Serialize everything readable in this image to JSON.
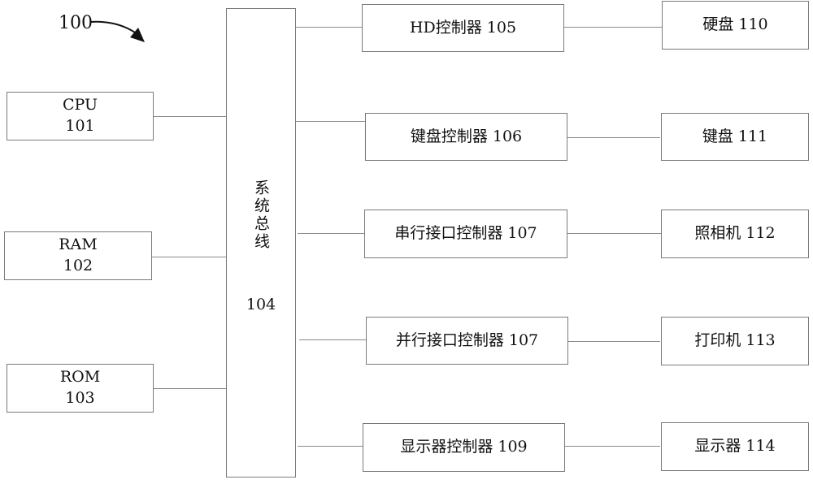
{
  "figure_ref": "100",
  "bus": {
    "title": "系统总线",
    "number": "104"
  },
  "left_components": [
    {
      "name": "CPU",
      "number": "101"
    },
    {
      "name": "RAM",
      "number": "102"
    },
    {
      "name": "ROM",
      "number": "103"
    }
  ],
  "controllers": [
    {
      "label": "HD控制器  105"
    },
    {
      "label": "键盘控制器  106"
    },
    {
      "label": "串行接口控制器  107"
    },
    {
      "label": "并行接口控制器  107"
    },
    {
      "label": "显示器控制器  109"
    }
  ],
  "devices": [
    {
      "label": "硬盘  110"
    },
    {
      "label": "键盘  111"
    },
    {
      "label": "照相机  112"
    },
    {
      "label": "打印机  113"
    },
    {
      "label": "显示器  114"
    }
  ]
}
